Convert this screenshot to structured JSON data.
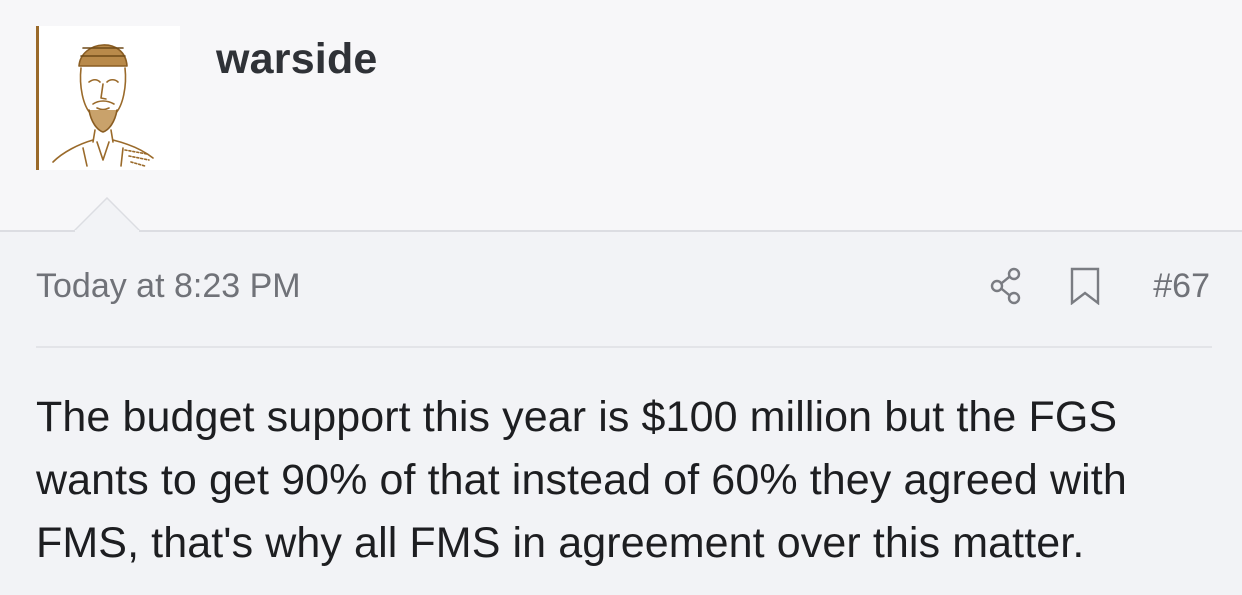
{
  "post": {
    "username": "warside",
    "timestamp": "Today at 8:23 PM",
    "post_number": "#67",
    "message": "The budget support this year is $100 million but the FGS wants to get 90% of that instead of 60% they agreed with FMS, that's why all FMS in agreement over this matter."
  },
  "icons": {
    "share": "share-icon",
    "bookmark": "bookmark-icon",
    "avatar": "avatar-illustration"
  },
  "colors": {
    "avatar_accent": "#9a6a2a",
    "username": "#2f3237",
    "meta_text": "#707278",
    "body_text": "#1d1e21"
  }
}
